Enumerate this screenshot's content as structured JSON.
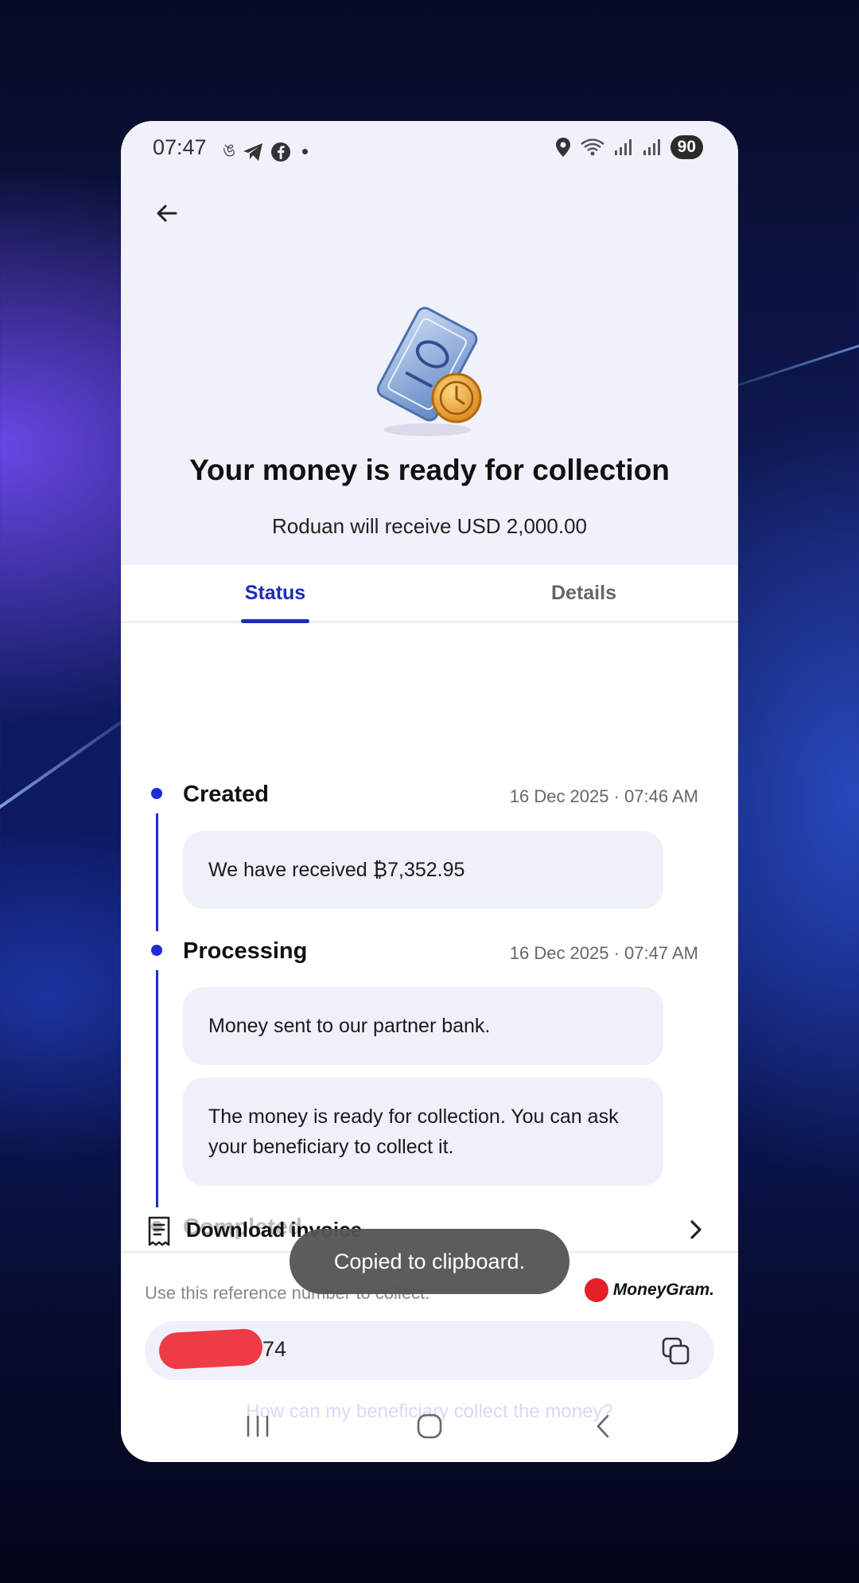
{
  "status_bar": {
    "time": "07:47",
    "battery": "90"
  },
  "hero": {
    "title": "Your money is ready for collection",
    "subtitle": "Roduan will receive USD 2,000.00"
  },
  "tabs": [
    {
      "label": "Status",
      "selected": true
    },
    {
      "label": "Details",
      "selected": false
    }
  ],
  "timeline": {
    "steps": [
      {
        "title": "Created",
        "time": "16 Dec 2025 · 07:46 AM",
        "done": true
      },
      {
        "title": "Processing",
        "time": "16 Dec 2025 · 07:47 AM",
        "done": true
      },
      {
        "title": "Completed",
        "time": "",
        "done": false
      }
    ],
    "cards": [
      "We have received ₿7,352.95",
      "Money sent to our partner bank.",
      "The money is ready for collection. You can ask your beneficiary to collect it."
    ]
  },
  "invoice": {
    "label": "Download invoice"
  },
  "reference": {
    "label": "Use this reference number to collect:",
    "brand": "MoneyGram.",
    "value_visible_suffix": "74",
    "help_link": "How can my beneficiary collect the money?"
  },
  "toast": {
    "message": "Copied to clipboard."
  },
  "colors": {
    "accent": "#1f2bd6",
    "card_bg": "#eef0fa",
    "hero_bg": "#f0f1fa",
    "moneygram_red": "#e4202a"
  }
}
